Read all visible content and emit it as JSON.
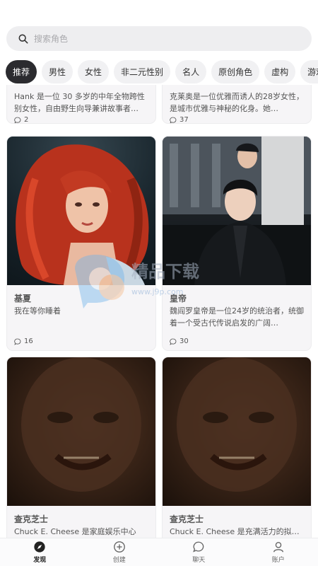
{
  "search": {
    "placeholder": "搜索角色"
  },
  "tabs": [
    "推荐",
    "男性",
    "女性",
    "非二元性别",
    "名人",
    "原创角色",
    "虚构",
    "游戏"
  ],
  "partial_cards": [
    {
      "desc": "Hank 是一位 30 多岁的中年全物跨性别女性，自由野生向导兼讲故事者…",
      "count": "2"
    },
    {
      "desc": "克莱奥是一位优雅而诱人的28岁女性，是城市优雅与神秘的化身。她…",
      "count": "37"
    }
  ],
  "cards": [
    {
      "name": "基夏",
      "desc": "我在等你睡着",
      "count": "16",
      "image": "red-haired-woman"
    },
    {
      "name": "皇帝",
      "desc": "魏阎罗皇帝是一位24岁的统治者，统御着一个受古代传说启发的广阔…",
      "count": "30",
      "image": "emperor-in-suit"
    },
    {
      "name": "查克芝士",
      "desc": "Chuck E. Cheese 是家庭娱乐中心的…",
      "count": "",
      "image": "dark-face"
    },
    {
      "name": "查克芝士",
      "desc": "Chuck E. Cheese 是充满活力的拟…",
      "count": "",
      "image": "dark-face"
    }
  ],
  "watermark": {
    "text": "精品下载",
    "url": "www.j9p.com"
  },
  "bottom_nav": [
    {
      "label": "发现",
      "icon": "compass-icon",
      "active": true
    },
    {
      "label": "创建",
      "icon": "plus-circle-icon",
      "active": false
    },
    {
      "label": "聊天",
      "icon": "chat-bubble-icon",
      "active": false
    },
    {
      "label": "账户",
      "icon": "user-icon",
      "active": false
    }
  ]
}
